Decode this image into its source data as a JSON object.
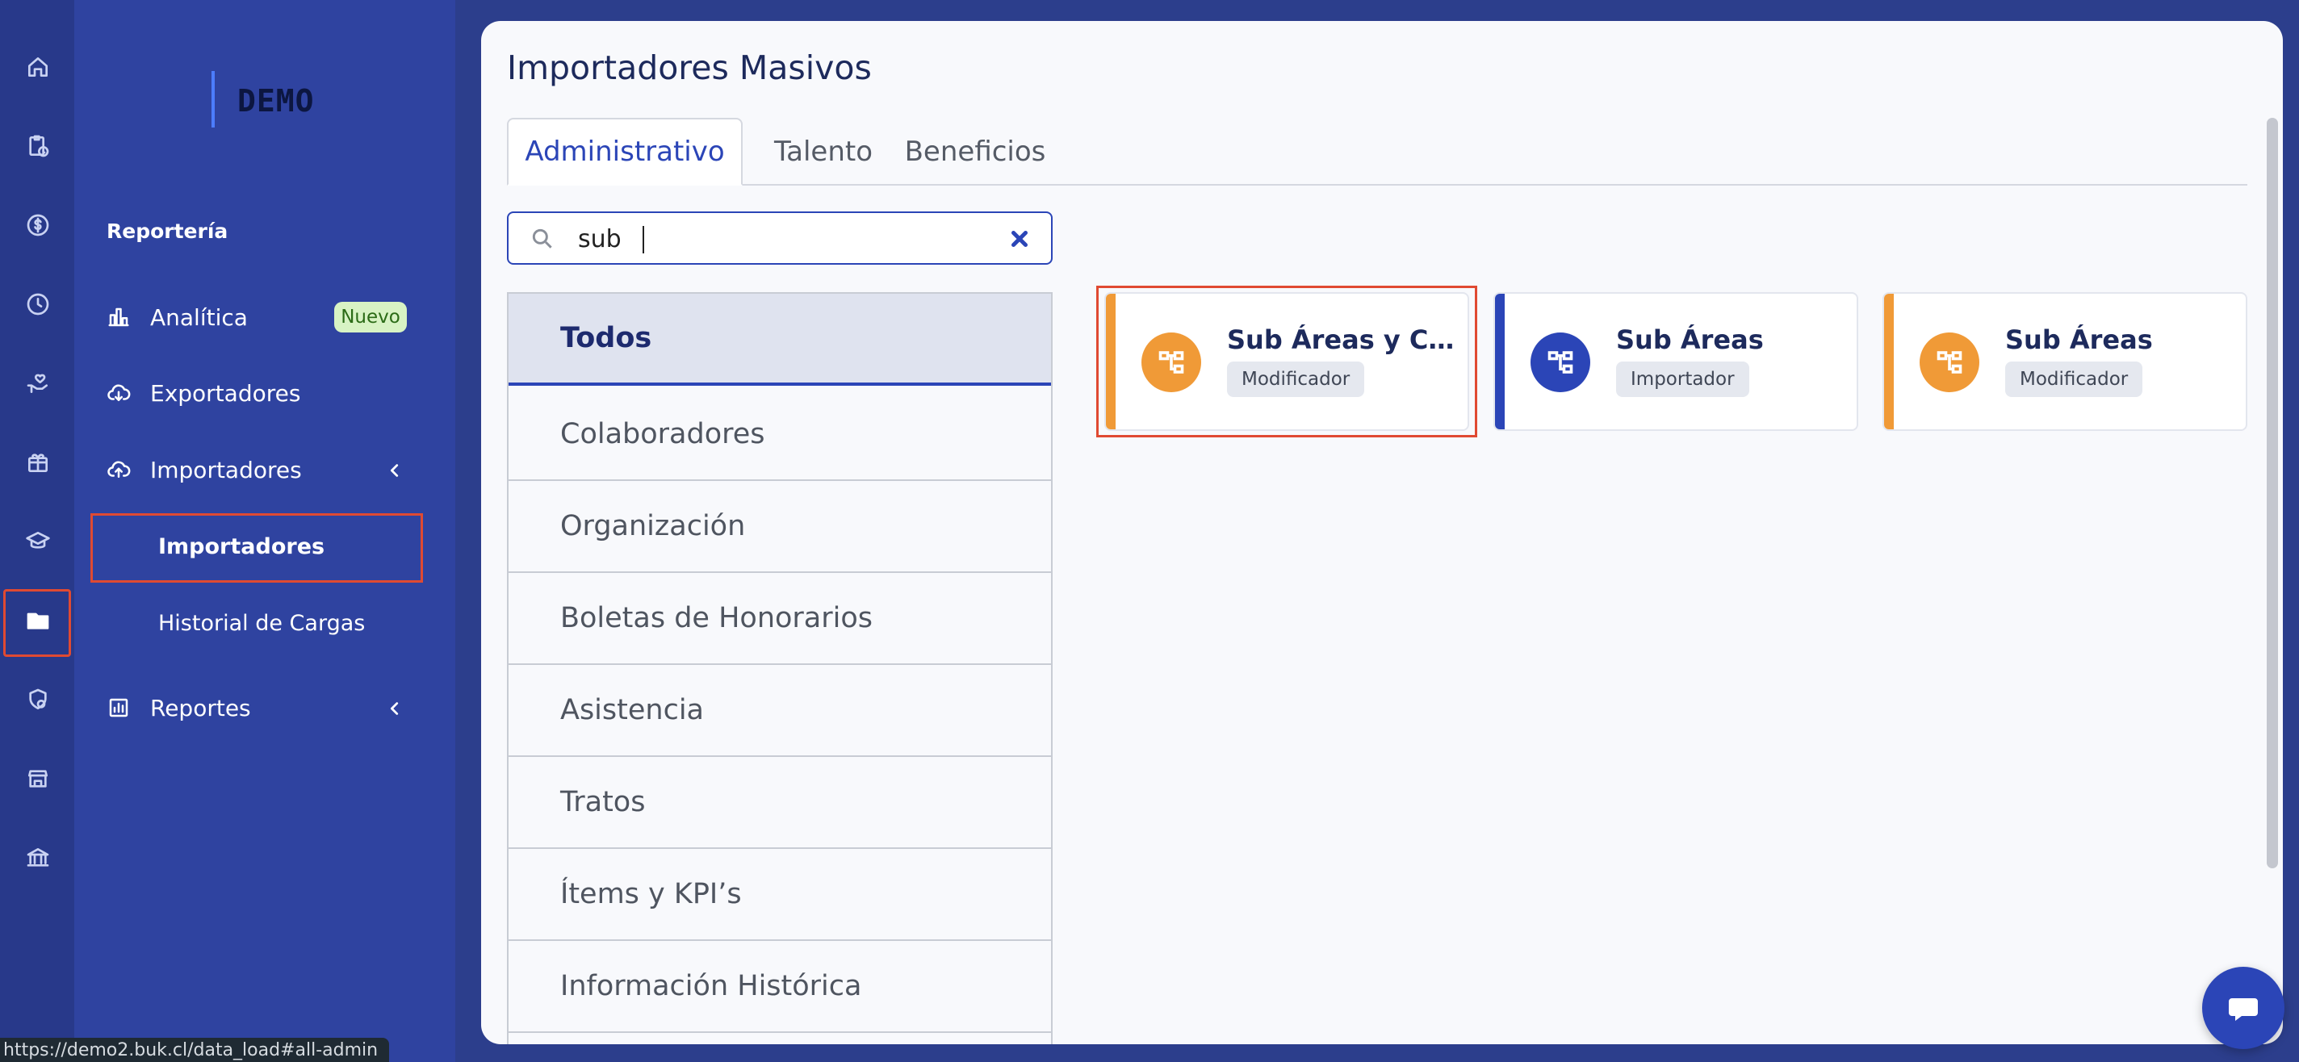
{
  "colors": {
    "rail_bg": "#28398a",
    "sidebar_bg": "#2f43a0",
    "accent_blue": "#2b45b7",
    "accent_orange": "#f09a37",
    "highlight_red": "#e04a32",
    "badge_green_bg": "#d8f3c4"
  },
  "rail": {
    "icons": [
      "home-icon",
      "clipboard-clock-icon",
      "dollar-icon",
      "clock-icon",
      "hand-heart-icon",
      "gift-icon",
      "graduation-cap-icon",
      "folder-icon",
      "shield-user-icon",
      "store-icon",
      "bank-icon"
    ],
    "active": "folder-icon"
  },
  "sidebar": {
    "logo": "DEMO",
    "section_title": "Reportería",
    "items": [
      {
        "label": "Analítica",
        "icon": "bar-chart-icon",
        "badge": "Nuevo"
      },
      {
        "label": "Exportadores",
        "icon": "cloud-download-icon"
      },
      {
        "label": "Importadores",
        "icon": "cloud-upload-icon",
        "expanded": true
      },
      {
        "label": "Reportes",
        "icon": "report-icon"
      }
    ],
    "sub_items": [
      {
        "label": "Importadores",
        "active": true
      },
      {
        "label": "Historial de Cargas"
      }
    ]
  },
  "status_url": "https://demo2.buk.cl/data_load#all-admin",
  "main": {
    "title": "Importadores Masivos",
    "tabs": [
      {
        "label": "Administrativo",
        "active": true
      },
      {
        "label": "Talento"
      },
      {
        "label": "Beneficios"
      }
    ],
    "search": {
      "value": "sub",
      "placeholder": ""
    },
    "categories": [
      {
        "label": "Todos",
        "active": true
      },
      {
        "label": "Colaboradores"
      },
      {
        "label": "Organización"
      },
      {
        "label": "Boletas de Honorarios"
      },
      {
        "label": "Asistencia"
      },
      {
        "label": "Tratos"
      },
      {
        "label": "Ítems y KPI’s"
      },
      {
        "label": "Información Histórica"
      }
    ],
    "results": [
      {
        "title": "Sub Áreas y Car...",
        "tag": "Modificador",
        "color": "#f09a37",
        "icon": "org-chart-icon"
      },
      {
        "title": "Sub Áreas",
        "tag": "Importador",
        "color": "#2b45b7",
        "icon": "org-chart-icon"
      },
      {
        "title": "Sub Áreas",
        "tag": "Modificador",
        "color": "#f09a37",
        "icon": "org-chart-icon"
      }
    ]
  },
  "chat_button": {
    "icon": "chat-bubble-icon"
  }
}
